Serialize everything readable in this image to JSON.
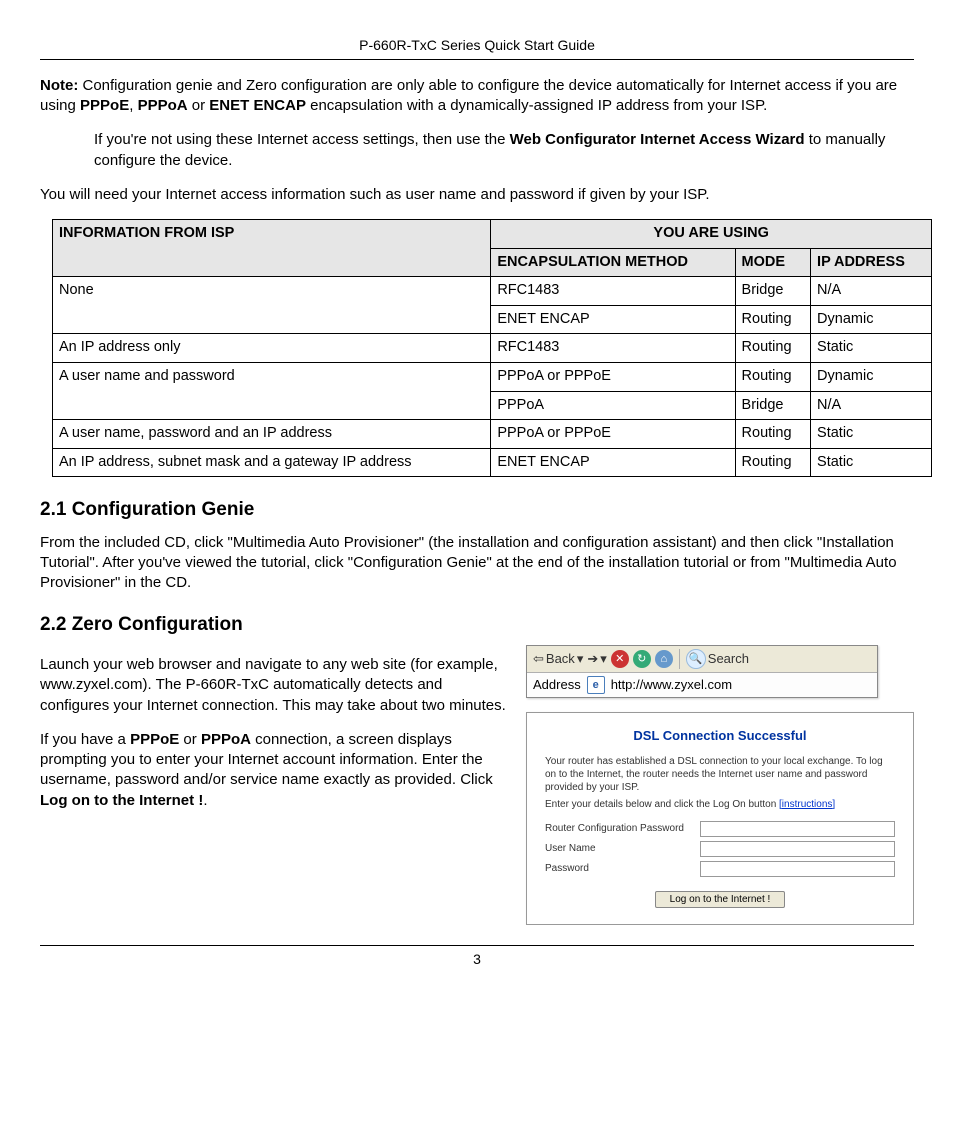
{
  "header": {
    "title": "P-660R-TxC Series Quick Start Guide"
  },
  "note": {
    "label": "Note:",
    "p1a": "Configuration genie and Zero configuration are only able to configure the device automatically for Internet access if you are using ",
    "p1b1": "PPPoE",
    "p1sep1": ", ",
    "p1b2": "PPPoA",
    "p1sep2": " or ",
    "p1b3": "ENET ENCAP",
    "p1c": " encapsulation with a dynamically-assigned IP address from your ISP.",
    "p2a": "If you're not using these Internet access settings, then use the ",
    "p2b": "Web Configurator Internet Access Wizard",
    "p2c": " to manually configure the device."
  },
  "intro": "You will need your Internet access information such as user name and password if given by your ISP.",
  "table": {
    "h_info": "INFORMATION FROM ISP",
    "h_using": "YOU ARE USING",
    "h_encap": "ENCAPSULATION METHOD",
    "h_mode": "MODE",
    "h_ip": "IP ADDRESS",
    "rows": [
      {
        "info": "None",
        "encap": "RFC1483",
        "mode": "Bridge",
        "ip": "N/A"
      },
      {
        "info": "",
        "encap": "ENET ENCAP",
        "mode": "Routing",
        "ip": "Dynamic"
      },
      {
        "info": "An IP address only",
        "encap": "RFC1483",
        "mode": "Routing",
        "ip": "Static"
      },
      {
        "info": "A user name and password",
        "encap": "PPPoA or PPPoE",
        "mode": "Routing",
        "ip": "Dynamic"
      },
      {
        "info": "",
        "encap": "PPPoA",
        "mode": "Bridge",
        "ip": "N/A"
      },
      {
        "info": "A user name, password and an IP address",
        "encap": "PPPoA or PPPoE",
        "mode": "Routing",
        "ip": "Static"
      },
      {
        "info": "An IP address, subnet mask and a gateway IP address",
        "encap": "ENET ENCAP",
        "mode": "Routing",
        "ip": "Static"
      }
    ]
  },
  "sec21": {
    "title": "2.1 Configuration Genie",
    "body": "From the included CD, click \"Multimedia Auto Provisioner\" (the installation and configuration assistant) and then click \"Installation Tutorial\". After you've viewed the tutorial, click \"Configuration Genie\" at the end of the installation tutorial or from \"Multimedia Auto Provisioner\" in the CD."
  },
  "sec22": {
    "title": "2.2 Zero Configuration",
    "p1": "Launch your web browser and navigate to any web site (for example, www.zyxel.com). The P-660R-TxC automatically detects and configures your Internet connection. This may take about two minutes.",
    "p2a": "If you have a ",
    "p2b1": "PPPoE",
    "p2sep": " or ",
    "p2b2": "PPPoA",
    "p2c": " connection, a screen displays prompting you to enter your Internet account information. Enter the username, password and/or service name exactly as provided. Click ",
    "p2d": "Log on to the Internet !",
    "p2e": "."
  },
  "toolbar": {
    "back": "Back",
    "search": "Search",
    "addr_label": "Address",
    "url": "http://www.zyxel.com"
  },
  "dialog": {
    "title": "DSL Connection Successful",
    "msg1": "Your router has established a DSL connection to your local exchange. To log on to the Internet, the router needs the Internet user name and password provided by your ISP.",
    "msg2a": "Enter your details below and click the Log On button ",
    "msg2link": "[instructions]",
    "lbl_cfg": "Router Configuration Password",
    "lbl_user": "User Name",
    "lbl_pass": "Password",
    "btn": "Log on to the Internet !"
  },
  "page": "3"
}
